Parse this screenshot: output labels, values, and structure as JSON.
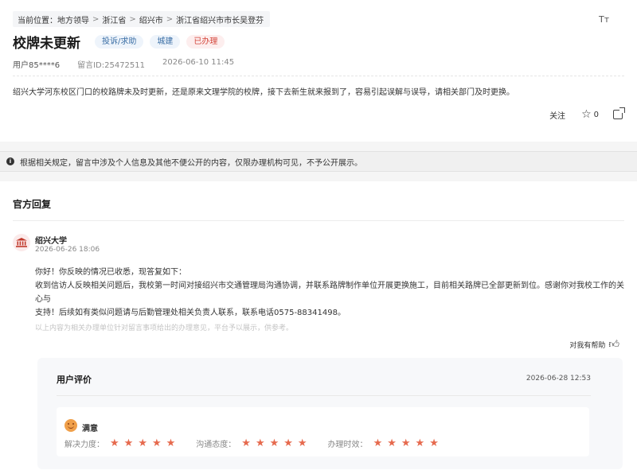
{
  "breadcrumb": {
    "prefix": "当前位置：",
    "items": [
      "地方领导",
      "浙江省",
      "绍兴市",
      "浙江省绍兴市市长吴登芬"
    ],
    "separator": ">"
  },
  "font_size_icon": "Tт",
  "title": "校牌未更新",
  "tags": [
    "投诉/求助",
    "城建",
    "已办理"
  ],
  "meta": {
    "user": "用户85****6",
    "message_id": "留言ID:25472511",
    "date": "2026-06-10 11:45"
  },
  "content": "绍兴大学河东校区门口的校路牌未及时更新，还是原来文理学院的校牌，接下去新生就来报到了，容易引起误解与误导，请相关部门及时更换。",
  "actions": {
    "follow_label": "关注",
    "star_count": "0"
  },
  "notice": {
    "icon_text": "i",
    "text": "根据相关规定，留言中涉及个人信息及其他不便公开的内容，仅限办理机构可见，不予公开展示。"
  },
  "reply": {
    "header": "官方回复",
    "org_name": "绍兴大学",
    "time": "2026-06-26 18:06",
    "lines": [
      "你好！你反映的情况已收悉，现答复如下：",
      "收到信访人反映相关问题后，我校第一时间对接绍兴市交通管理局沟通协调，并联系路牌制作单位开展更换施工，目前相关路牌已全部更新到位。感谢你对我校工作的关心与",
      "支持！后续如有类似问题请与后勤管理处相关负责人联系，联系电话0575-88341498。"
    ],
    "note": "以上内容为相关办理单位针对留言事项给出的办理意见，平台予以展示，供参考。",
    "helpful_label": "对我有帮助"
  },
  "evaluation": {
    "title": "用户评价",
    "time": "2026-06-28 12:53",
    "result": "满意",
    "ratings": [
      {
        "label": "解决力度：",
        "stars": 5
      },
      {
        "label": "沟通态度：",
        "stars": 5
      },
      {
        "label": "办理时效：",
        "stars": 5
      }
    ],
    "star_color": "#e66a4e"
  },
  "colors": {
    "tag_blue_text": "#3a6ea5",
    "tag_red_text": "#d4453a",
    "avatar_icon": "#c0392b"
  }
}
